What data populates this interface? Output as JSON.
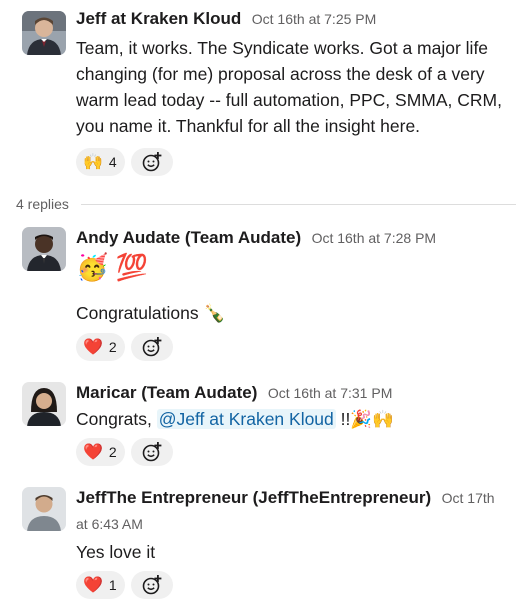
{
  "thread": {
    "parent": {
      "author": "Jeff at Kraken Kloud",
      "timestamp": "Oct 16th at 7:25 PM",
      "text": "Team, it works. The Syndicate works. Got a major life changing (for me) proposal across the desk of a very warm lead today -- full automation, PPC, SMMA, CRM, you name it. Thankful for all the insight here.",
      "reaction": {
        "emoji": "🙌",
        "count": "4"
      }
    },
    "replies_label": "4 replies",
    "replies": [
      {
        "author": "Andy Audate (Team Audate)",
        "timestamp": "Oct 16th at 7:28 PM",
        "emoji_line": "🥳 💯",
        "text": "Congratulations 🍾",
        "reaction": {
          "emoji": "❤️",
          "count": "2"
        }
      },
      {
        "author": "Maricar (Team Audate)",
        "timestamp": "Oct 16th at 7:31 PM",
        "text_prefix": "Congrats, ",
        "mention": "@Jeff at Kraken Kloud",
        "text_suffix": " !!🎉🙌",
        "reaction": {
          "emoji": "❤️",
          "count": "2"
        }
      },
      {
        "author": "JeffThe Entrepreneur (JeffTheEntrepreneur)",
        "timestamp": "Oct 17th",
        "timestamp_cont": "at 6:43 AM",
        "text": "Yes love it",
        "reaction": {
          "emoji": "❤️",
          "count": "1"
        }
      }
    ]
  },
  "icons": {
    "add_reaction": "add-reaction-icon"
  }
}
